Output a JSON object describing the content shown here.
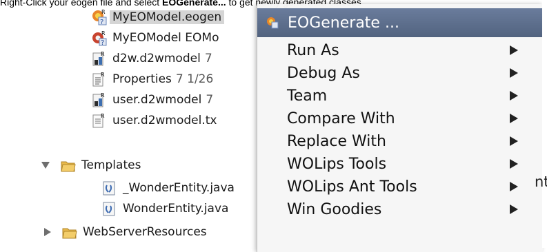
{
  "caption": {
    "prefix": "Right-Click your eogen file and select ",
    "action": "EOGenerate...",
    "suffix": " to get newly generated classes"
  },
  "tree": {
    "rows": [
      {
        "label": "MyEOModel.eogen",
        "suffix": "",
        "icon": "eogen-file-icon",
        "selected": true
      },
      {
        "label": "MyEOModel EOMo",
        "suffix": "",
        "icon": "eomodel-file-icon",
        "selected": false
      },
      {
        "label": "d2w.d2wmodel",
        "suffix": "7",
        "icon": "d2wmodel-file-icon",
        "selected": false
      },
      {
        "label": "Properties",
        "suffix": "7  1/26",
        "icon": "properties-file-icon",
        "selected": false
      },
      {
        "label": "user.d2wmodel",
        "suffix": "7",
        "icon": "d2wmodel-file-icon",
        "selected": false
      },
      {
        "label": "user.d2wmodel.tx",
        "suffix": "",
        "icon": "text-file-icon",
        "selected": false
      },
      {
        "label": "Templates",
        "suffix": "",
        "icon": "folder-icon",
        "selected": false
      },
      {
        "label": "_WonderEntity.java",
        "suffix": "",
        "icon": "java-template-icon",
        "selected": false
      },
      {
        "label": "WonderEntity.java",
        "suffix": "",
        "icon": "java-template-icon",
        "selected": false
      },
      {
        "label": "WebServerResources",
        "suffix": "",
        "icon": "folder-icon",
        "selected": false
      }
    ]
  },
  "menu": {
    "items": [
      {
        "label": "EOGenerate ...",
        "submenu": false,
        "highlighted": true,
        "icon": "eogenerate-icon"
      },
      {
        "label": "Run As",
        "submenu": true,
        "highlighted": false
      },
      {
        "label": "Debug As",
        "submenu": true,
        "highlighted": false
      },
      {
        "label": "Team",
        "submenu": true,
        "highlighted": false
      },
      {
        "label": "Compare With",
        "submenu": true,
        "highlighted": false
      },
      {
        "label": "Replace With",
        "submenu": true,
        "highlighted": false
      },
      {
        "label": "WOLips Tools",
        "submenu": true,
        "highlighted": false
      },
      {
        "label": "WOLips Ant Tools",
        "submenu": true,
        "highlighted": false
      },
      {
        "label": "Win Goodies",
        "submenu": true,
        "highlighted": false
      }
    ]
  },
  "partial_right_text": "nt",
  "colors": {
    "menu_highlight": "#5b6d8c",
    "selection": "#d5d5d5",
    "folder": "#e8b84a"
  }
}
